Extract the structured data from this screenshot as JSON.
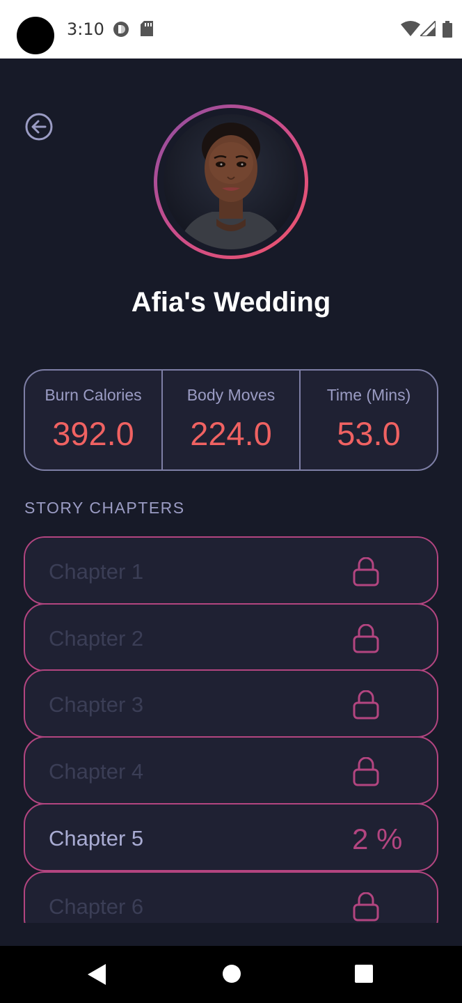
{
  "status_bar": {
    "time": "3:10"
  },
  "header": {
    "title": "Afia's Wedding"
  },
  "stats": [
    {
      "label": "Burn Calories",
      "value": "392.0"
    },
    {
      "label": "Body Moves",
      "value": "224.0"
    },
    {
      "label": "Time (Mins)",
      "value": "53.0"
    }
  ],
  "section": {
    "title": "STORY CHAPTERS"
  },
  "chapters": [
    {
      "label": "Chapter 1",
      "status": "locked",
      "icon": "lock-icon"
    },
    {
      "label": "Chapter 2",
      "status": "locked",
      "icon": "lock-icon"
    },
    {
      "label": "Chapter 3",
      "status": "locked",
      "icon": "lock-icon"
    },
    {
      "label": "Chapter 4",
      "status": "locked",
      "icon": "lock-icon"
    },
    {
      "label": "Chapter 5",
      "status": "in-progress",
      "progress": "2 %"
    },
    {
      "label": "Chapter 6",
      "status": "locked",
      "icon": "lock-icon"
    }
  ],
  "colors": {
    "background": "#171a28",
    "accent": "#f06262",
    "chapter_border": "#b34580",
    "muted_text": "#9b9cc4"
  }
}
